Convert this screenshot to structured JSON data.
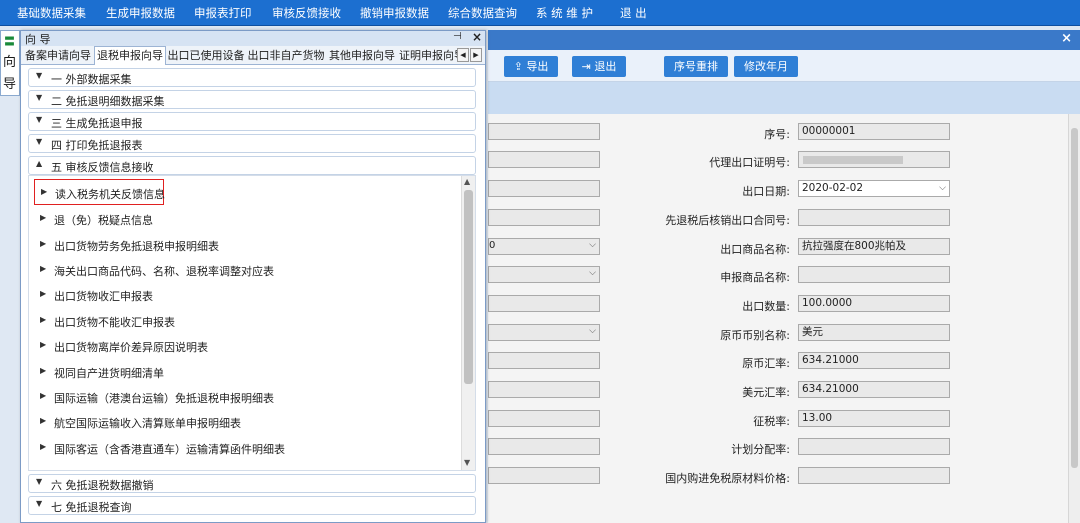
{
  "menu": [
    "基础数据采集",
    "生成申报数据",
    "申报表打印",
    "审核反馈接收",
    "撤销申报数据",
    "综合数据查询",
    "系 统 维 护",
    "退 出"
  ],
  "side_tab": {
    "icon": "guide-icon",
    "chars": [
      "向",
      "导"
    ]
  },
  "guide": {
    "title": "向 导",
    "pin_glyph": "⊣",
    "close_glyph": "×",
    "tabs": [
      "备案申请向导",
      "退税申报向导",
      "出口已使用设备",
      "出口非自产货物",
      "其他申报向导",
      "证明申报向导"
    ],
    "active_tab_index": 1,
    "sections": [
      {
        "label": "一  外部数据采集",
        "expanded": false
      },
      {
        "label": "二  免抵退明细数据采集",
        "expanded": false
      },
      {
        "label": "三  生成免抵退申报",
        "expanded": false
      },
      {
        "label": "四  打印免抵退报表",
        "expanded": false
      },
      {
        "label": "五  审核反馈信息接收",
        "expanded": true
      }
    ],
    "items": [
      "读入税务机关反馈信息",
      "退（免）税疑点信息",
      "出口货物劳务免抵退税申报明细表",
      "海关出口商品代码、名称、退税率调整对应表",
      "出口货物收汇申报表",
      "出口货物不能收汇申报表",
      "出口货物离岸价差异原因说明表",
      "视同自产进货明细清单",
      "国际运输（港澳台运输）免抵退税申报明细表",
      "航空国际运输收入清算账单申报明细表",
      "国际客运（含香港直通车）运输清算函件明细表"
    ],
    "highlighted_item_index": 0,
    "bottom_sections": [
      {
        "label": "六  免抵退税数据撤销",
        "expanded": false
      },
      {
        "label": "七  免抵退税查询",
        "expanded": false
      }
    ]
  },
  "main": {
    "close_glyph": "×",
    "toolbar": [
      {
        "label": "导出",
        "icon": "export-icon"
      },
      {
        "label": "退出",
        "icon": "exit-icon"
      },
      {
        "label": "序号重排"
      },
      {
        "label": "修改年月"
      }
    ],
    "left_fragment": "0",
    "fields": [
      {
        "label": "序号:",
        "value": "00000001"
      },
      {
        "label": "代理出口证明号:",
        "value": ""
      },
      {
        "label": "出口日期:",
        "value": "2020-02-02",
        "dropdown": true
      },
      {
        "label": "先退税后核销出口合同号:",
        "value": ""
      },
      {
        "label": "出口商品名称:",
        "value": "抗拉强度在800兆帕及"
      },
      {
        "label": "申报商品名称:",
        "value": ""
      },
      {
        "label": "出口数量:",
        "value": "100.0000"
      },
      {
        "label": "原币币别名称:",
        "value": "美元"
      },
      {
        "label": "原币汇率:",
        "value": "634.21000"
      },
      {
        "label": "美元汇率:",
        "value": "634.21000"
      },
      {
        "label": "征税率:",
        "value": "13.00"
      },
      {
        "label": "计划分配率:",
        "value": ""
      },
      {
        "label": "国内购进免税原材料价格:",
        "value": ""
      }
    ]
  }
}
